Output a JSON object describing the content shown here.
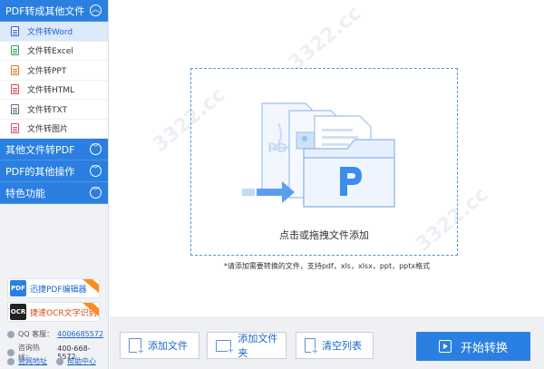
{
  "sidebar": {
    "categories": [
      {
        "label": "PDF转成其他文件",
        "expanded": true
      },
      {
        "label": "其他文件转PDF",
        "expanded": false
      },
      {
        "label": "PDF的其他操作",
        "expanded": false
      },
      {
        "label": "特色功能",
        "expanded": false
      }
    ],
    "sub_items": [
      {
        "label": "文件转Word",
        "icon": "word-file-icon",
        "active": true
      },
      {
        "label": "文件转Excel",
        "icon": "excel-file-icon",
        "active": false
      },
      {
        "label": "文件转PPT",
        "icon": "ppt-file-icon",
        "active": false
      },
      {
        "label": "文件转HTML",
        "icon": "html-file-icon",
        "active": false
      },
      {
        "label": "文件转TXT",
        "icon": "txt-file-icon",
        "active": false
      },
      {
        "label": "文件转图片",
        "icon": "image-file-icon",
        "active": false
      }
    ],
    "promos": [
      {
        "label": "迅捷PDF编辑器",
        "logo_text": "PDF"
      },
      {
        "label": "捷速OCR文字识别",
        "logo_text": "OCR"
      }
    ],
    "contact": {
      "qq_label": "QQ 客服：",
      "qq_value": "4006685572",
      "phone_label": "咨询热线：",
      "phone_value": "400-668-5572",
      "website_link": "官网地址",
      "help_link": "帮助中心"
    }
  },
  "main": {
    "drop_label": "点击或拖拽文件添加",
    "hint": "*请添加需要转换的文件，支持pdf，xls，xlsx，ppt，pptx格式",
    "watermark": "3322.cc"
  },
  "toolbar": {
    "add_file": "添加文件",
    "add_folder": "添加文件夹",
    "clear_list": "清空列表",
    "start": "开始转换"
  },
  "colors": {
    "accent": "#2a7fe0",
    "sidebar_bg": "#f1f2f6",
    "active_item_bg": "#dbe9fb"
  }
}
